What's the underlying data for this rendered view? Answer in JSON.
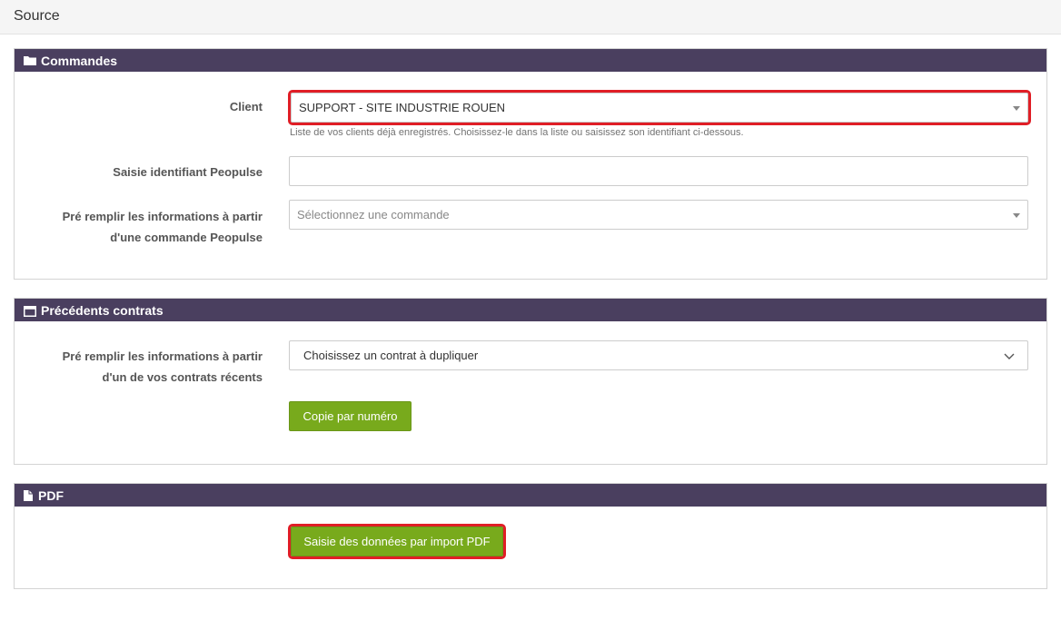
{
  "page": {
    "title": "Source"
  },
  "commandes": {
    "header": "Commandes",
    "client_label": "Client",
    "client_value": "SUPPORT - SITE INDUSTRIE ROUEN",
    "client_help": "Liste de vos clients déjà enregistrés. Choisissez-le dans la liste ou saisissez son identifiant ci-dessous.",
    "id_label": "Saisie identifiant Peopulse",
    "id_value": "",
    "prefill_label_line1": "Pré remplir les informations à partir",
    "prefill_label_line2": "d'une commande Peopulse",
    "prefill_placeholder": "Sélectionnez une commande"
  },
  "contrats": {
    "header": "Précédents contrats",
    "prefill_label_line1": "Pré remplir les informations à partir",
    "prefill_label_line2": "d'un de vos contrats récents",
    "select_placeholder": "Choisissez un contrat à dupliquer",
    "copy_button": "Copie par numéro"
  },
  "pdf": {
    "header": "PDF",
    "import_button": "Saisie des données par import PDF"
  },
  "colors": {
    "header_bg": "#4a3f5f",
    "button_green": "#78aa1c",
    "highlight_red": "#e01e26"
  },
  "icons": {
    "commandes": "folder-icon",
    "contrats": "calendar-icon",
    "pdf": "file-icon"
  }
}
